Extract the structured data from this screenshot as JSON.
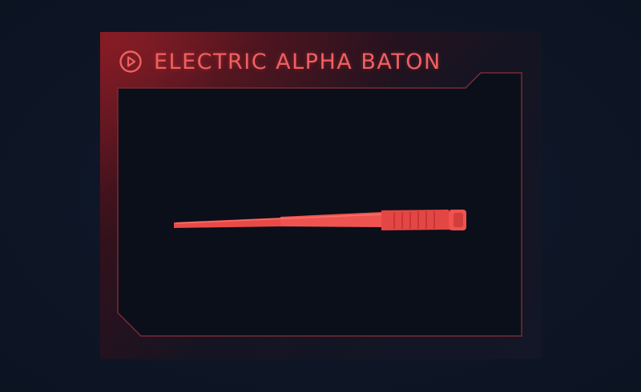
{
  "item": {
    "title": "ELECTRIC ALPHA BATON",
    "title_icon": "play-circle-icon"
  },
  "preview": {
    "weapon_icon": "baton-icon"
  },
  "colors": {
    "background": "#0f1828",
    "accent": "#f06060",
    "frame_line": "#7a2a34",
    "inner_panel": "#0b0f1a",
    "weapon": "#f0524f"
  }
}
